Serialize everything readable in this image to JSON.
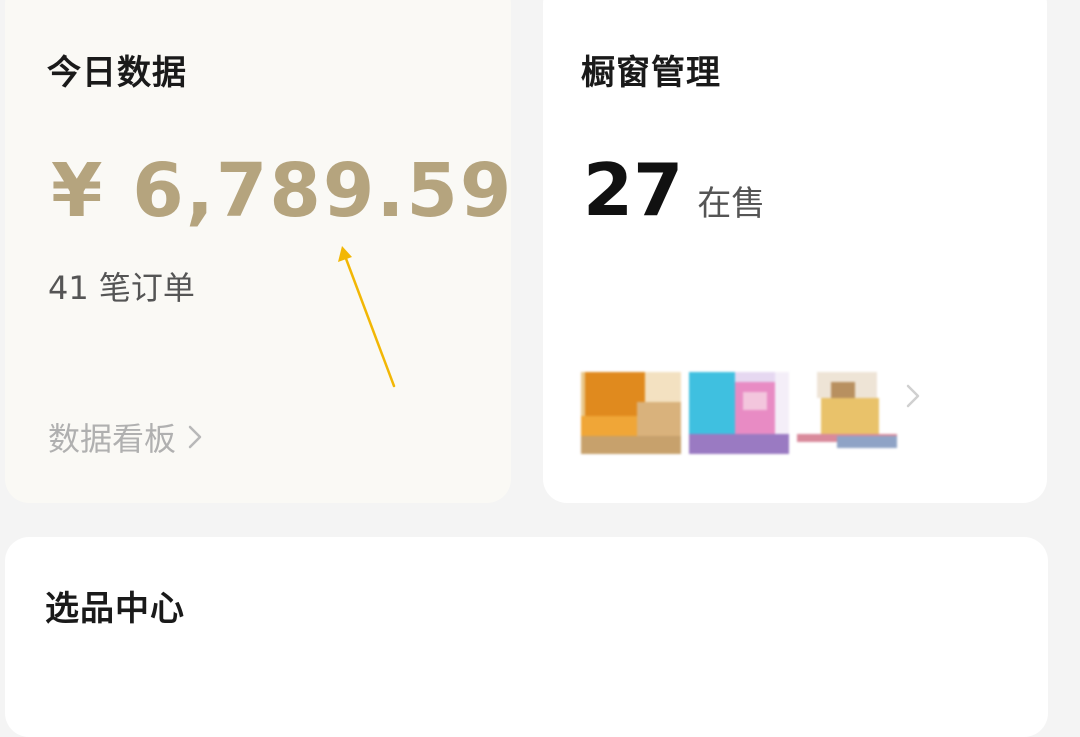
{
  "today_card": {
    "title": "今日数据",
    "amount": "¥ 6,789.59",
    "orders": "41 笔订单",
    "link_label": "数据看板"
  },
  "window_card": {
    "title": "橱窗管理",
    "count": "27",
    "count_label": "在售",
    "thumbnails": [
      "product-thumbnail",
      "product-thumbnail",
      "product-thumbnail"
    ]
  },
  "selection_card": {
    "title": "选品中心"
  },
  "colors": {
    "amount": "#b5a47e",
    "annotation_arrow": "#f2b705",
    "page_background": "#f4f4f4"
  }
}
